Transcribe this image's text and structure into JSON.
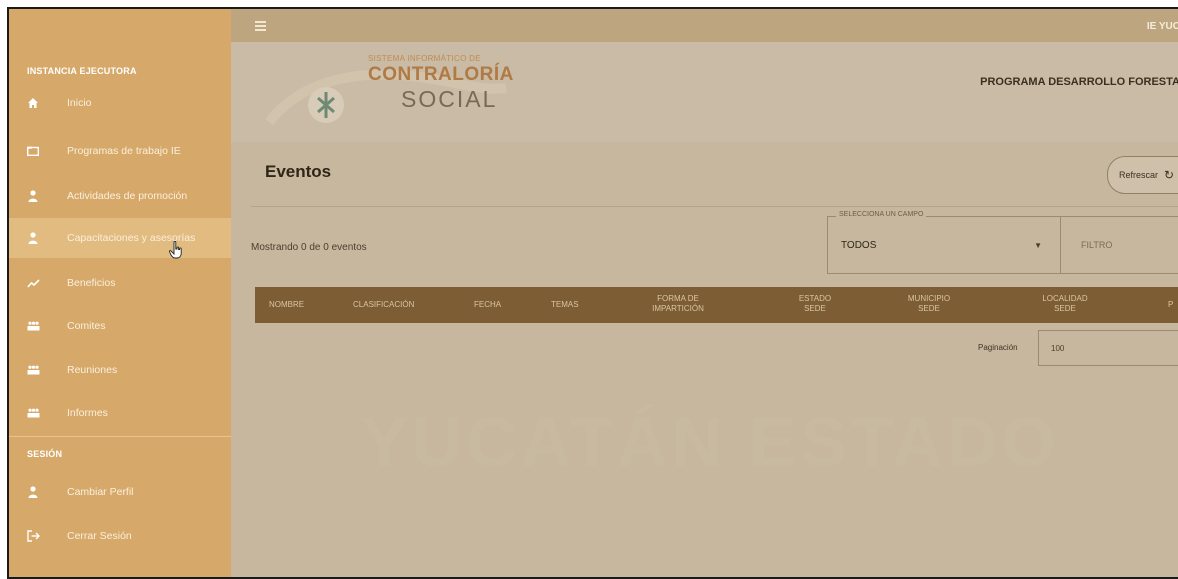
{
  "sidebar": {
    "section_executor": "INSTANCIA EJECUTORA",
    "items": [
      {
        "label": "Inicio",
        "icon": "home-icon"
      },
      {
        "label": "Programas de trabajo IE",
        "icon": "folder-icon"
      },
      {
        "label": "Actividades de promoción",
        "icon": "person-icon"
      },
      {
        "label": "Capacitaciones y asesorías",
        "icon": "person-icon"
      },
      {
        "label": "Beneficios",
        "icon": "trend-icon"
      },
      {
        "label": "Comites",
        "icon": "group-icon"
      },
      {
        "label": "Reuniones",
        "icon": "group-icon"
      },
      {
        "label": "Informes",
        "icon": "group-icon"
      }
    ],
    "section_session": "SESIÓN",
    "session_items": [
      {
        "label": "Cambiar Perfil",
        "icon": "person-icon"
      },
      {
        "label": "Cerrar Sesión",
        "icon": "logout-icon"
      }
    ]
  },
  "topbar": {
    "right_text": "IE YUC"
  },
  "header": {
    "logo_small": "SISTEMA INFORMÁTICO DE",
    "logo_big": "CONTRALORÍA",
    "logo_social": "SOCIAL",
    "program": "PROGRAMA DESARROLLO FORESTA"
  },
  "page": {
    "title": "Eventos",
    "refresh_label": "Refrescar",
    "showing": "Mostrando 0 de 0 eventos",
    "select_legend": "SELECCIONA UN CAMPO",
    "select_value": "TODOS",
    "filter_placeholder": "FILTRO",
    "pagination_label": "Paginación",
    "pagination_value": "100",
    "watermark": "YUCATÁN ESTADO"
  },
  "table": {
    "columns": [
      "NOMBRE",
      "CLASIFICACIÓN",
      "FECHA",
      "TEMAS",
      "FORMA DE IMPARTICIÓN",
      "ESTADO SEDE",
      "MUNICIPIO SEDE",
      "LOCALIDAD SEDE",
      "P"
    ]
  },
  "colors": {
    "sidebar": "#d6a96a",
    "table_header": "#7d5d33",
    "overlay": "#c6b79e"
  }
}
